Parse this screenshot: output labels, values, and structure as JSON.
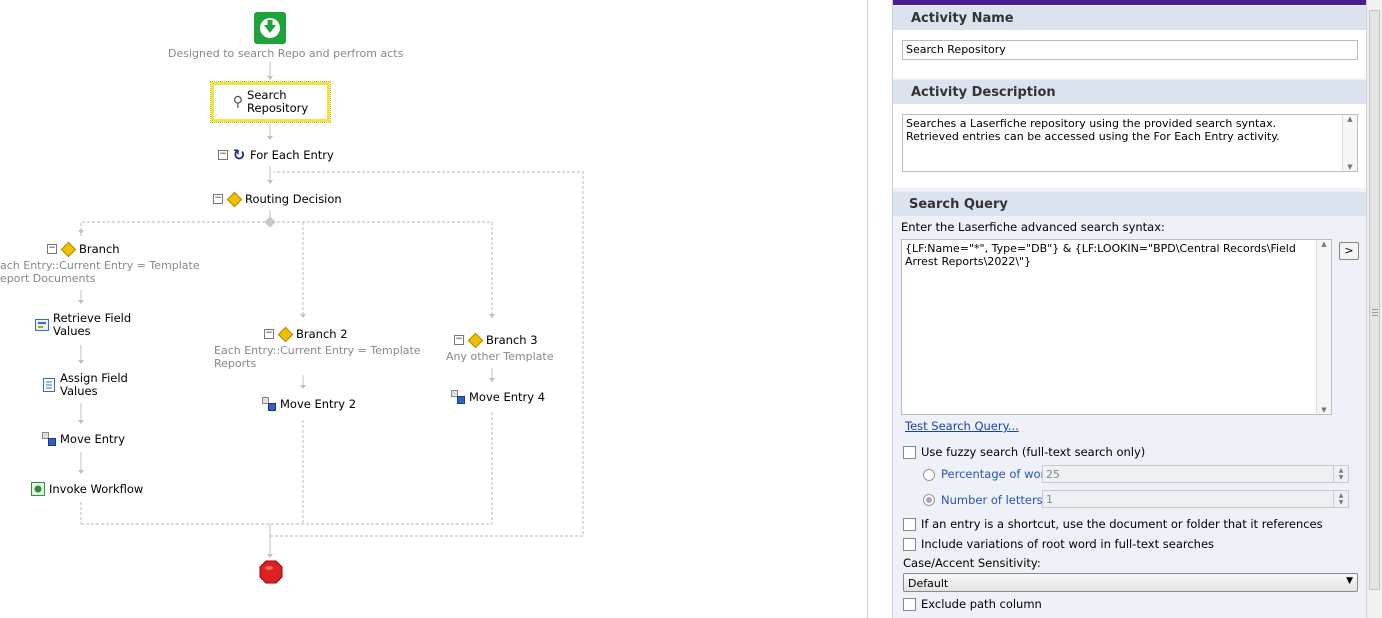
{
  "workflow": {
    "start_caption": "Designed to search Repo and perfrom acts",
    "search_repository": "Search\nRepository",
    "for_each_entry": "For Each Entry",
    "routing_decision": "Routing Decision",
    "branch1": {
      "label": "Branch",
      "condition": "ach Entry::Current Entry = Template\neport Documents"
    },
    "branch2": {
      "label": "Branch 2",
      "condition": "Each Entry::Current Entry = Template\nReports"
    },
    "branch3": {
      "label": "Branch 3",
      "condition": "Any other Template"
    },
    "retrieve_field_values": "Retrieve Field\nValues",
    "assign_field_values": "Assign Field\nValues",
    "move_entry": "Move Entry",
    "invoke_workflow": "Invoke Workflow",
    "move_entry_2": "Move Entry 2",
    "move_entry_4": "Move Entry 4"
  },
  "panel": {
    "activity_name_header": "Activity Name",
    "activity_name_value": "Search Repository",
    "activity_description_header": "Activity Description",
    "activity_description_value": "Searches a Laserfiche repository using the provided search syntax.  Retrieved entries can be accessed using the For Each Entry activity.",
    "search_query_header": "Search Query",
    "search_syntax_label": "Enter the Laserfiche advanced search syntax:",
    "search_query_value": "{LF:Name=\"*\", Type=\"DB\"} & {LF:LOOKIN=\"BPD\\Central Records\\Field Arrest Reports\\2022\\\"}",
    "expand_button": ">",
    "test_link": "Test Search Query...",
    "fuzzy_label": "Use fuzzy search (full-text search only)",
    "percentage_label": "Percentage of word:",
    "percentage_value": "25",
    "letters_label": "Number of letters:",
    "letters_value": "1",
    "shortcut_label": "If an entry is a shortcut, use the document or folder that it references",
    "variations_label": "Include variations of root word in full-text searches",
    "sensitivity_label": "Case/Accent Sensitivity:",
    "sensitivity_value": "Default",
    "exclude_label": "Exclude path column"
  },
  "colors": {
    "accent_bar": "#4b1d8f",
    "start_green": "#1ea23a",
    "stop_red": "#e02020",
    "selection_yellow": "#f2e24a",
    "link_blue": "#1a3fb0"
  }
}
